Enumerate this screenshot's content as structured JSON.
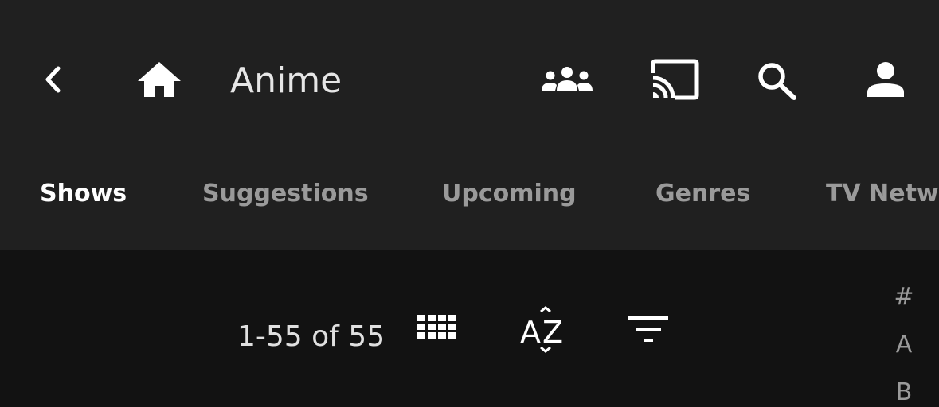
{
  "header": {
    "title": "Anime",
    "icons": {
      "back": "chevron-left-icon",
      "home": "home-icon",
      "users": "users-icon",
      "cast": "cast-icon",
      "search": "search-icon",
      "account": "account-icon"
    }
  },
  "tabs": [
    {
      "label": "Shows",
      "active": true
    },
    {
      "label": "Suggestions",
      "active": false
    },
    {
      "label": "Upcoming",
      "active": false
    },
    {
      "label": "Genres",
      "active": false
    },
    {
      "label": "TV Networks",
      "active": false
    }
  ],
  "toolbar": {
    "count_label": "1-55 of 55",
    "icons": {
      "view": "grid-view-icon",
      "sort": "sort-az-icon",
      "filter": "filter-icon"
    }
  },
  "jump_bar": [
    "#",
    "A",
    "B"
  ],
  "colors": {
    "header_bg": "#202020",
    "body_bg": "#121212",
    "active_tab": "#ffffff",
    "inactive_tab": "#9a9a9a"
  }
}
